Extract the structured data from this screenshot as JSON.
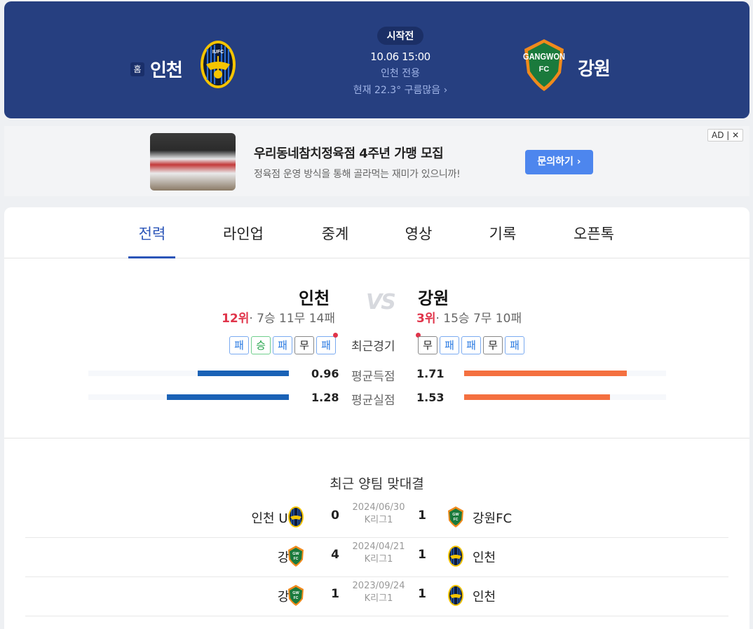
{
  "header": {
    "home_badge": "홈",
    "home_team": "인천",
    "away_team": "강원",
    "status": "시작전",
    "datetime": "10.06 15:00",
    "venue": "인천 전용",
    "weather": "현재 22.3° 구름많음 ›",
    "home_logo_text": "IUFC",
    "away_logo_text": "GANGWON",
    "away_logo_sub": "FC",
    "colors": {
      "header_bg": "#263f80",
      "accent": "#2b55b8",
      "rank_red": "#e0344a",
      "home_bar": "#1a62b6",
      "away_bar": "#f47040"
    }
  },
  "ad": {
    "title": "우리동네참치정육점 4주년 가맹 모집",
    "description": "정육점 운영 방식을 통해 골라먹는 재미가 있으니까!",
    "button": "문의하기 ›",
    "tag": "AD | ✕"
  },
  "tabs": [
    "전력",
    "라인업",
    "중계",
    "영상",
    "기록",
    "오픈톡"
  ],
  "comparison": {
    "vs": "VS",
    "home": {
      "name": "인천",
      "rank": "12위",
      "record": "· 7승 11무 14패",
      "recent": [
        "패",
        "승",
        "패",
        "무",
        "패"
      ]
    },
    "away": {
      "name": "강원",
      "rank": "3위",
      "record": "· 15승 7무 10패",
      "recent": [
        "무",
        "패",
        "패",
        "무",
        "패"
      ]
    },
    "recent_label": "최근경기",
    "stats": [
      {
        "label": "평균득점",
        "home": "0.96",
        "away": "1.71",
        "home_value": 0.96,
        "away_value": 1.71
      },
      {
        "label": "평균실점",
        "home": "1.28",
        "away": "1.53",
        "home_value": 1.28,
        "away_value": 1.53
      }
    ]
  },
  "h2h": {
    "title": "최근 양팀 맞대결",
    "matches": [
      {
        "left_team": "인천 Utd",
        "left_logo": "incheon",
        "left_score": "0",
        "date": "2024/06/30",
        "league": "K리그1",
        "right_score": "1",
        "right_team": "강원FC",
        "right_logo": "gangwon"
      },
      {
        "left_team": "강원",
        "left_logo": "gangwon",
        "left_score": "4",
        "date": "2024/04/21",
        "league": "K리그1",
        "right_score": "1",
        "right_team": "인천",
        "right_logo": "incheon"
      },
      {
        "left_team": "강원",
        "left_logo": "gangwon",
        "left_score": "1",
        "date": "2023/09/24",
        "league": "K리그1",
        "right_score": "1",
        "right_team": "인천",
        "right_logo": "incheon"
      }
    ]
  }
}
